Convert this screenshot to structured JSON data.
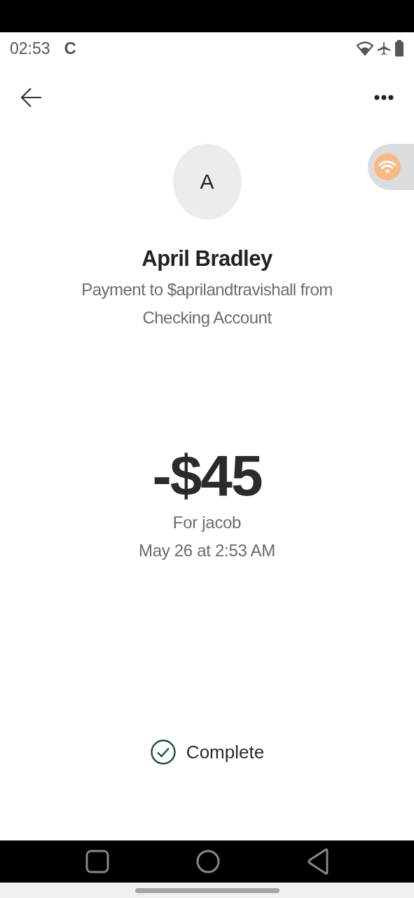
{
  "status_bar": {
    "time": "02:53",
    "carrier_letter": "C"
  },
  "recipient": {
    "initial": "A",
    "name": "April Bradley",
    "description": "Payment to $aprilandtravishall from Checking Account"
  },
  "payment": {
    "amount": "-$45",
    "note": "For jacob",
    "date": "May 26 at 2:53 AM"
  },
  "status": {
    "label": "Complete",
    "complete": true
  }
}
